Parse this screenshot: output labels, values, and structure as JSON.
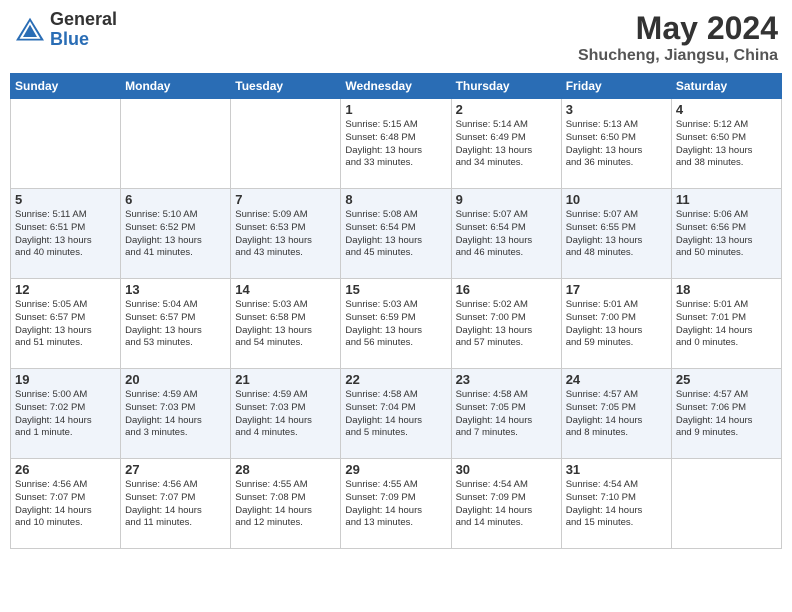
{
  "header": {
    "logo_general": "General",
    "logo_blue": "Blue",
    "title": "May 2024",
    "location": "Shucheng, Jiangsu, China"
  },
  "days_of_week": [
    "Sunday",
    "Monday",
    "Tuesday",
    "Wednesday",
    "Thursday",
    "Friday",
    "Saturday"
  ],
  "weeks": [
    {
      "alt": false,
      "days": [
        {
          "num": "",
          "info": "",
          "empty": true
        },
        {
          "num": "",
          "info": "",
          "empty": true
        },
        {
          "num": "",
          "info": "",
          "empty": true
        },
        {
          "num": "1",
          "info": "Sunrise: 5:15 AM\nSunset: 6:48 PM\nDaylight: 13 hours\nand 33 minutes.",
          "empty": false
        },
        {
          "num": "2",
          "info": "Sunrise: 5:14 AM\nSunset: 6:49 PM\nDaylight: 13 hours\nand 34 minutes.",
          "empty": false
        },
        {
          "num": "3",
          "info": "Sunrise: 5:13 AM\nSunset: 6:50 PM\nDaylight: 13 hours\nand 36 minutes.",
          "empty": false
        },
        {
          "num": "4",
          "info": "Sunrise: 5:12 AM\nSunset: 6:50 PM\nDaylight: 13 hours\nand 38 minutes.",
          "empty": false
        }
      ]
    },
    {
      "alt": true,
      "days": [
        {
          "num": "5",
          "info": "Sunrise: 5:11 AM\nSunset: 6:51 PM\nDaylight: 13 hours\nand 40 minutes.",
          "empty": false
        },
        {
          "num": "6",
          "info": "Sunrise: 5:10 AM\nSunset: 6:52 PM\nDaylight: 13 hours\nand 41 minutes.",
          "empty": false
        },
        {
          "num": "7",
          "info": "Sunrise: 5:09 AM\nSunset: 6:53 PM\nDaylight: 13 hours\nand 43 minutes.",
          "empty": false
        },
        {
          "num": "8",
          "info": "Sunrise: 5:08 AM\nSunset: 6:54 PM\nDaylight: 13 hours\nand 45 minutes.",
          "empty": false
        },
        {
          "num": "9",
          "info": "Sunrise: 5:07 AM\nSunset: 6:54 PM\nDaylight: 13 hours\nand 46 minutes.",
          "empty": false
        },
        {
          "num": "10",
          "info": "Sunrise: 5:07 AM\nSunset: 6:55 PM\nDaylight: 13 hours\nand 48 minutes.",
          "empty": false
        },
        {
          "num": "11",
          "info": "Sunrise: 5:06 AM\nSunset: 6:56 PM\nDaylight: 13 hours\nand 50 minutes.",
          "empty": false
        }
      ]
    },
    {
      "alt": false,
      "days": [
        {
          "num": "12",
          "info": "Sunrise: 5:05 AM\nSunset: 6:57 PM\nDaylight: 13 hours\nand 51 minutes.",
          "empty": false
        },
        {
          "num": "13",
          "info": "Sunrise: 5:04 AM\nSunset: 6:57 PM\nDaylight: 13 hours\nand 53 minutes.",
          "empty": false
        },
        {
          "num": "14",
          "info": "Sunrise: 5:03 AM\nSunset: 6:58 PM\nDaylight: 13 hours\nand 54 minutes.",
          "empty": false
        },
        {
          "num": "15",
          "info": "Sunrise: 5:03 AM\nSunset: 6:59 PM\nDaylight: 13 hours\nand 56 minutes.",
          "empty": false
        },
        {
          "num": "16",
          "info": "Sunrise: 5:02 AM\nSunset: 7:00 PM\nDaylight: 13 hours\nand 57 minutes.",
          "empty": false
        },
        {
          "num": "17",
          "info": "Sunrise: 5:01 AM\nSunset: 7:00 PM\nDaylight: 13 hours\nand 59 minutes.",
          "empty": false
        },
        {
          "num": "18",
          "info": "Sunrise: 5:01 AM\nSunset: 7:01 PM\nDaylight: 14 hours\nand 0 minutes.",
          "empty": false
        }
      ]
    },
    {
      "alt": true,
      "days": [
        {
          "num": "19",
          "info": "Sunrise: 5:00 AM\nSunset: 7:02 PM\nDaylight: 14 hours\nand 1 minute.",
          "empty": false
        },
        {
          "num": "20",
          "info": "Sunrise: 4:59 AM\nSunset: 7:03 PM\nDaylight: 14 hours\nand 3 minutes.",
          "empty": false
        },
        {
          "num": "21",
          "info": "Sunrise: 4:59 AM\nSunset: 7:03 PM\nDaylight: 14 hours\nand 4 minutes.",
          "empty": false
        },
        {
          "num": "22",
          "info": "Sunrise: 4:58 AM\nSunset: 7:04 PM\nDaylight: 14 hours\nand 5 minutes.",
          "empty": false
        },
        {
          "num": "23",
          "info": "Sunrise: 4:58 AM\nSunset: 7:05 PM\nDaylight: 14 hours\nand 7 minutes.",
          "empty": false
        },
        {
          "num": "24",
          "info": "Sunrise: 4:57 AM\nSunset: 7:05 PM\nDaylight: 14 hours\nand 8 minutes.",
          "empty": false
        },
        {
          "num": "25",
          "info": "Sunrise: 4:57 AM\nSunset: 7:06 PM\nDaylight: 14 hours\nand 9 minutes.",
          "empty": false
        }
      ]
    },
    {
      "alt": false,
      "days": [
        {
          "num": "26",
          "info": "Sunrise: 4:56 AM\nSunset: 7:07 PM\nDaylight: 14 hours\nand 10 minutes.",
          "empty": false
        },
        {
          "num": "27",
          "info": "Sunrise: 4:56 AM\nSunset: 7:07 PM\nDaylight: 14 hours\nand 11 minutes.",
          "empty": false
        },
        {
          "num": "28",
          "info": "Sunrise: 4:55 AM\nSunset: 7:08 PM\nDaylight: 14 hours\nand 12 minutes.",
          "empty": false
        },
        {
          "num": "29",
          "info": "Sunrise: 4:55 AM\nSunset: 7:09 PM\nDaylight: 14 hours\nand 13 minutes.",
          "empty": false
        },
        {
          "num": "30",
          "info": "Sunrise: 4:54 AM\nSunset: 7:09 PM\nDaylight: 14 hours\nand 14 minutes.",
          "empty": false
        },
        {
          "num": "31",
          "info": "Sunrise: 4:54 AM\nSunset: 7:10 PM\nDaylight: 14 hours\nand 15 minutes.",
          "empty": false
        },
        {
          "num": "",
          "info": "",
          "empty": true
        }
      ]
    }
  ]
}
